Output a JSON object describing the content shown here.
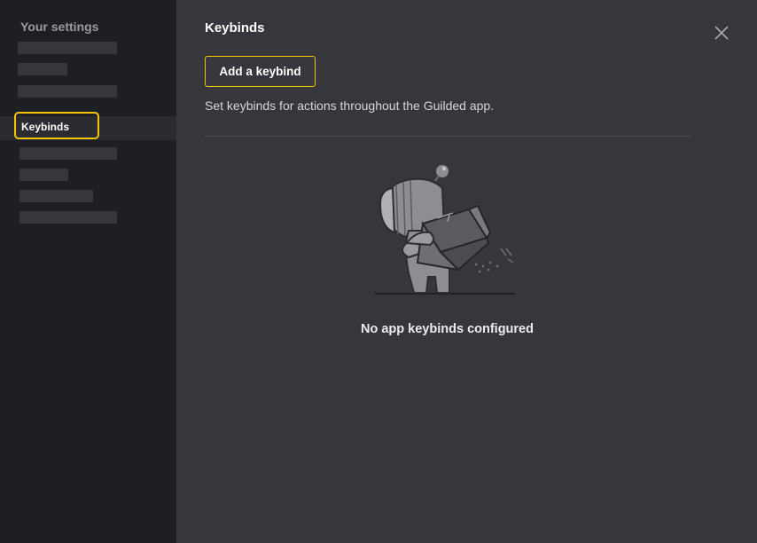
{
  "sidebar": {
    "heading": "Your settings",
    "active_item": "Keybinds"
  },
  "main": {
    "title": "Keybinds",
    "add_button_label": "Add a keybind",
    "description": "Set keybinds for actions throughout the Guilded app.",
    "empty_state_text": "No app keybinds configured",
    "empty_state_icon": "robot-opening-empty-box-illustration",
    "close_icon": "close-icon"
  },
  "colors": {
    "accent": "#f5c400",
    "sidebar_bg": "#1e1f24",
    "main_bg": "#36363d"
  }
}
